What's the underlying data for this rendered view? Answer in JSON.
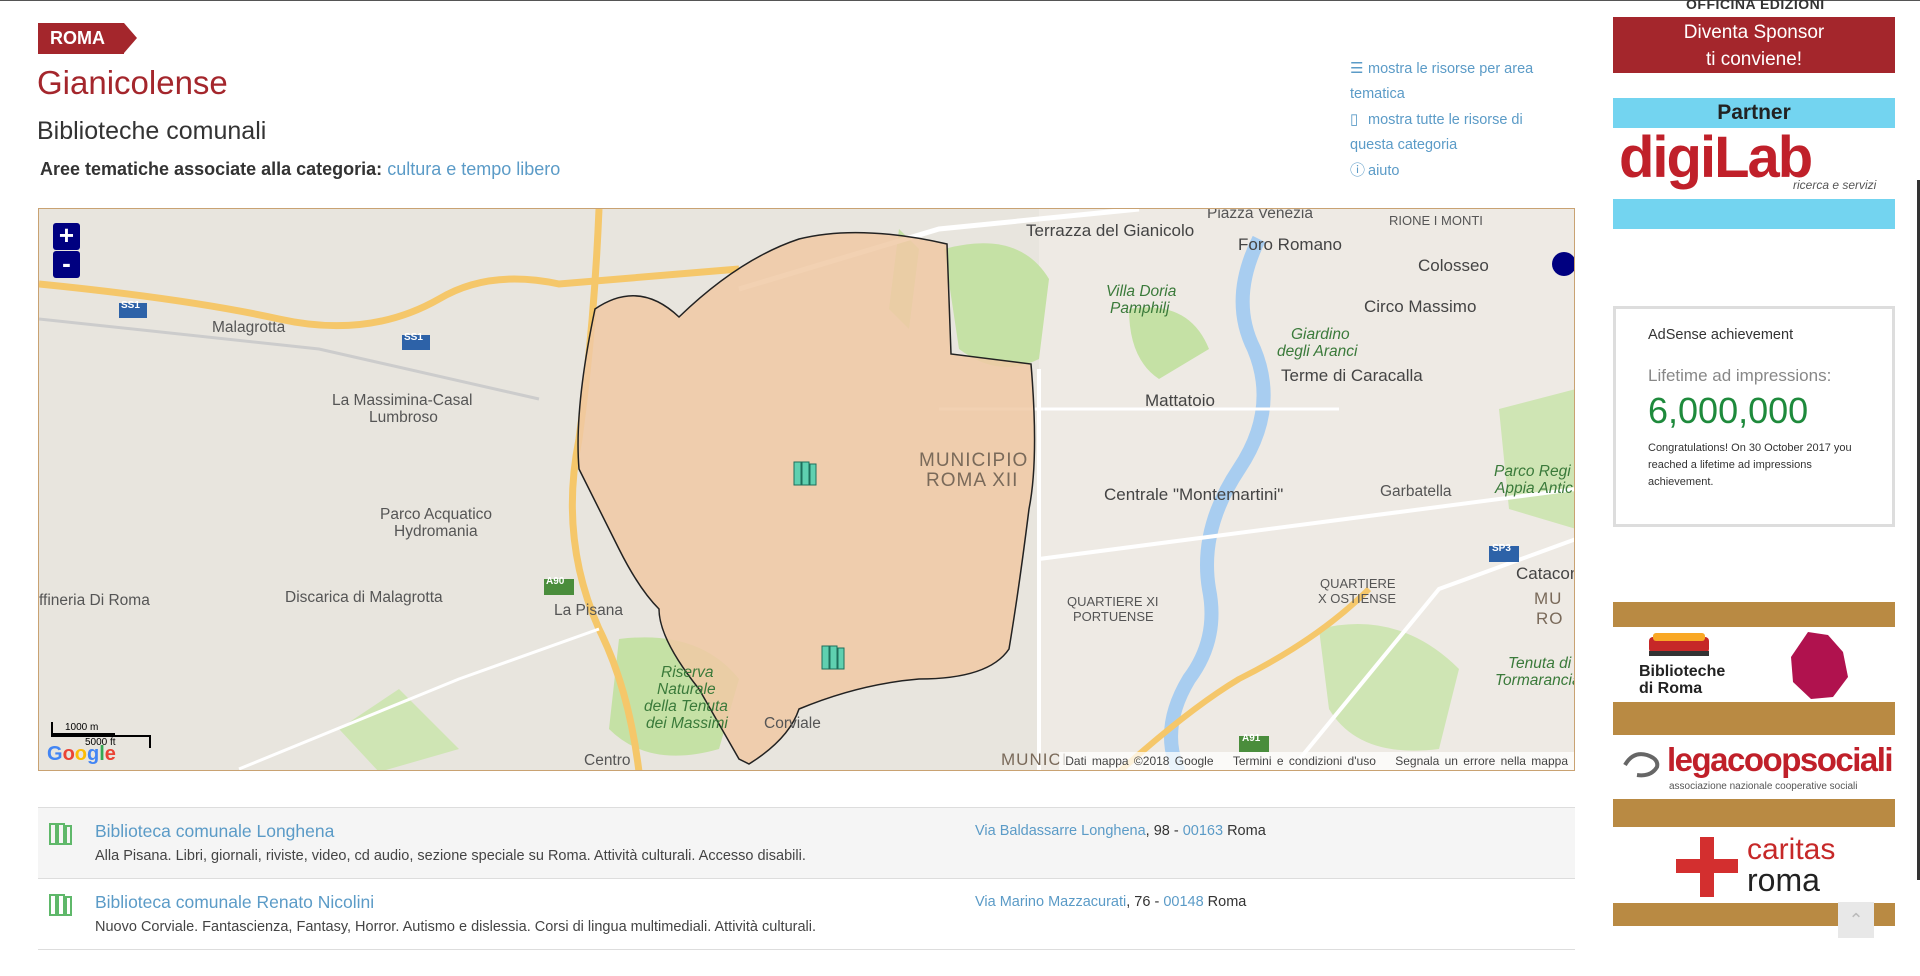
{
  "breadcrumb": "ROMA",
  "title": "Gianicolense",
  "subtitle": "Biblioteche comunali",
  "aree": {
    "label": "Aree tematiche associate alla categoria:",
    "link": "cultura e tempo libero"
  },
  "right_links": [
    {
      "icon": "list-icon",
      "text": "mostra le risorse per area tematica"
    },
    {
      "icon": "map-icon",
      "text": "mostra tutte le risorse di questa categoria"
    },
    {
      "icon": "info-icon",
      "text": "aiuto"
    }
  ],
  "map": {
    "zoom_in": "+",
    "zoom_out": "-",
    "labels": {
      "malagrotta": "Malagrotta",
      "massimina": "La Massimina-Casal",
      "lumbroso": "Lumbroso",
      "acquatico1": "Parco Acquatico",
      "acquatico2": "Hydromania",
      "raffineria": "ffineria Di Roma",
      "discarica": "Discarica di Malagrotta",
      "lapisana": "La Pisana",
      "riserva1": "Riserva",
      "riserva2": "Naturale",
      "riserva3": "della Tenuta",
      "riserva4": "dei Massimi",
      "corviale": "Corviale",
      "centro": "Centro",
      "terrazza": "Terrazza del Gianicolo",
      "piazzavenezia": "Piazza Venezia",
      "rione": "RIONE I MONTI",
      "foro": "Foro Romano",
      "colosseo": "Colosseo",
      "doria1": "Villa Doria",
      "doria2": "Pamphilj",
      "circo": "Circo Massimo",
      "giardino1": "Giardino",
      "giardino2": "degli Aranci",
      "terme": "Terme di Caracalla",
      "mattatoio": "Mattatoio",
      "muni1": "MUNICIPIO",
      "muni2": "ROMA XII",
      "montemartini": "Centrale \"Montemartini\"",
      "garbatella": "Garbatella",
      "appia1": "Parco Regi",
      "appia2": "Appia Antic",
      "q11a": "QUARTIERE XI",
      "q11b": "PORTUENSE",
      "q10a": "QUARTIERE",
      "q10b": "X OSTIENSE",
      "catacom": "Catacom",
      "tormarancia1": "Tenuta di",
      "tormarancia2": "Tormarancia",
      "municbottom": "MUNICI",
      "muniright1": "MU",
      "muniright2": "RO"
    },
    "roads": {
      "ss1a": "SS1",
      "ss1b": "SS1",
      "a90": "A90",
      "a91": "A91",
      "sp3": "SP3"
    },
    "scale_m": "1000 m",
    "scale_ft": "5000 ft",
    "google": "Google",
    "copyright": "Dati mappa ©2018 Google",
    "terms": "Termini e condizioni d'uso",
    "report": "Segnala un errore nella mappa"
  },
  "results": [
    {
      "name": "Biblioteca comunale Longhena",
      "desc": "Alla Pisana. Libri, giornali, riviste, video, cd audio, sezione speciale su Roma. Attività culturali. Accesso disabili.",
      "street": "Via Baldassarre Longhena",
      "number": ", 98 - ",
      "cap": "00163",
      "city": " Roma"
    },
    {
      "name": "Biblioteca comunale Renato Nicolini",
      "desc": "Nuovo Corviale. Fantascienza, Fantasy, Horror. Autismo e dislessia. Corsi di lingua multimediali. Attività culturali.",
      "street": "Via Marino Mazzacurati",
      "number": ", 76 - ",
      "cap": "00148",
      "city": " Roma"
    }
  ],
  "sidebar": {
    "officina": "OFFICINA EDIZIONI",
    "sponsor_line1": "Diventa Sponsor",
    "sponsor_line2": "ti conviene!",
    "partner": "Partner",
    "digilab": "digiLab",
    "digilab_sub": "ricerca e servizi",
    "adsense_head": "AdSense achievement",
    "adsense_label": "Lifetime ad impressions:",
    "adsense_number": "6,000,000",
    "adsense_congrats": "Congratulations! On 30 October 2017 you reached a lifetime ad impressions achievement.",
    "biblio1": "Biblioteche",
    "biblio2": "di Roma",
    "legacoop": "legacoopsociali",
    "legacoop_sub": "associazione nazionale cooperative sociali",
    "caritas1": "caritas",
    "caritas2": "roma"
  },
  "colors": {
    "brand": "#a4262c",
    "link": "#5b9bc7",
    "area": "#f0c9a4"
  }
}
